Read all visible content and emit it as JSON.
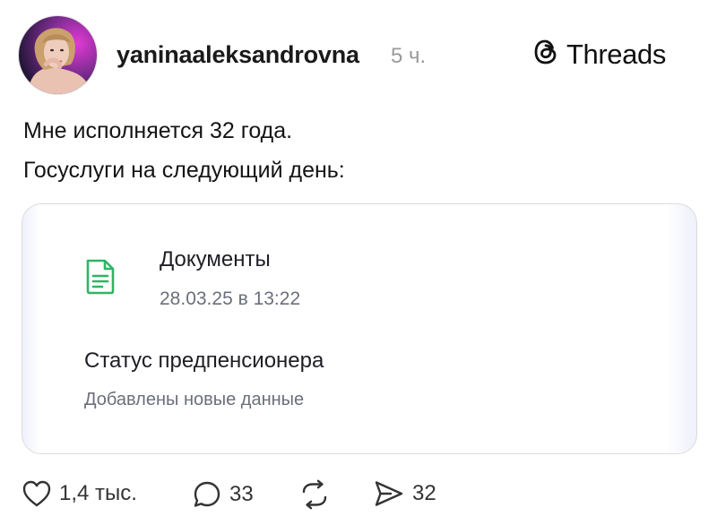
{
  "post": {
    "username": "yaninaaleksandrovna",
    "time_ago": "5 ч.",
    "app_name": "Threads",
    "lines": [
      "Мне исполняется 32 года.",
      "Госуслуги на следующий день:"
    ]
  },
  "card": {
    "section_title": "Документы",
    "date": "28.03.25 в 13:22",
    "status_title": "Статус предпенсионера",
    "status_subtitle": "Добавлены новые данные",
    "accent_color": "#2fb566"
  },
  "actions": {
    "likes": "1,4 тыс.",
    "replies": "33",
    "shares": "32"
  },
  "icons": {
    "avatar": "user-avatar",
    "logo": "threads-icon",
    "document": "document-icon",
    "like": "heart-icon",
    "reply": "comment-icon",
    "repost": "repost-icon",
    "share": "send-icon"
  }
}
